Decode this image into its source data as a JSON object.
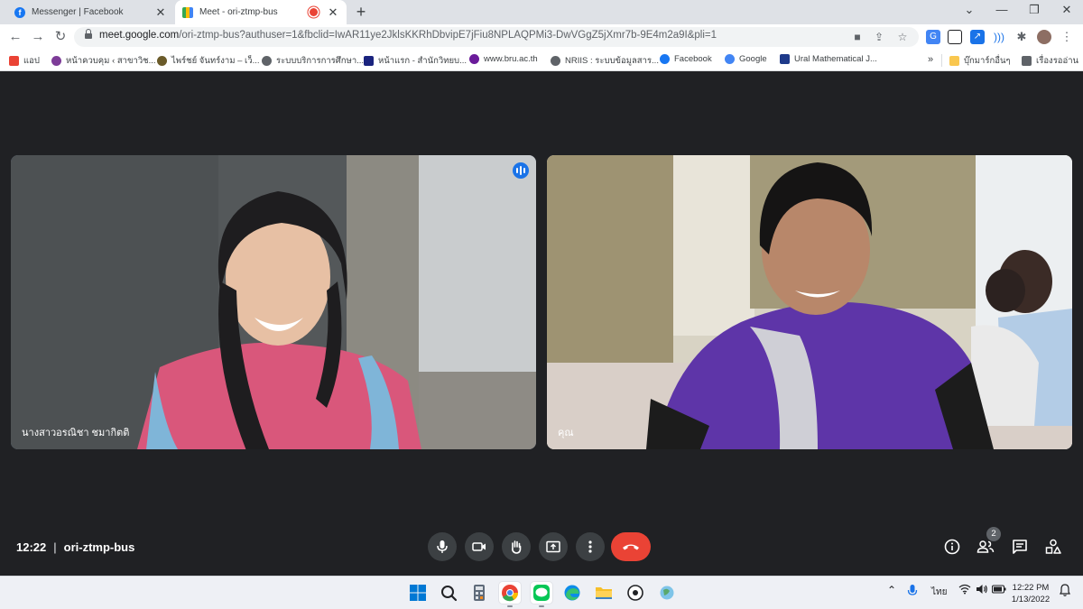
{
  "tabs": [
    {
      "title": "Messenger | Facebook",
      "favicon": "facebook-icon"
    },
    {
      "title": "Meet - ori-ztmp-bus",
      "favicon": "google-meet-icon",
      "recording": true
    }
  ],
  "address": {
    "host": "meet.google.com",
    "path": "/ori-ztmp-bus?authuser=1&fbclid=IwAR11ye2JklsKKRhDbvipE7jFiu8NPLAQPMi3-DwVGgZ5jXmr7b-9E4m2a9I&pli=1"
  },
  "bookmarks": [
    {
      "label": "แอป",
      "icon": "apps-grid-icon",
      "color": "#ea4335"
    },
    {
      "label": "หน้าควบคุม ‹ สาขาวิช...",
      "icon": "wordpress-icon",
      "color": "#7d3c98"
    },
    {
      "label": "ไพร์ชย์ จันทร์งาม – เว็...",
      "icon": "site-icon",
      "color": "#6b5b2a"
    },
    {
      "label": "ระบบบริการการศึกษา...",
      "icon": "globe-icon",
      "color": "#5f6368"
    },
    {
      "label": "หน้าแรก - สำนักวิทยบ...",
      "icon": "library-icon",
      "color": "#1a237e"
    },
    {
      "label": "www.bru.ac.th",
      "icon": "bru-icon",
      "color": "#6a1b9a"
    },
    {
      "label": "NRIIS : ระบบข้อมูลสาร...",
      "icon": "globe-icon",
      "color": "#5f6368"
    },
    {
      "label": "Facebook",
      "icon": "facebook-icon",
      "color": "#1877f2"
    },
    {
      "label": "Google",
      "icon": "google-icon",
      "color": "#4285f4"
    },
    {
      "label": "Ural Mathematical J...",
      "icon": "journal-icon",
      "color": "#1e3a8a"
    }
  ],
  "bookmarks_right": [
    {
      "label": "บุ๊กมาร์กอื่นๆ",
      "icon": "folder-icon",
      "color": "#f9c74f"
    },
    {
      "label": "เรื่องรออ่าน",
      "icon": "reading-list-icon",
      "color": "#5f6368"
    }
  ],
  "meeting": {
    "time": "12:22",
    "code": "ori-ztmp-bus",
    "participants_count": "2",
    "tiles": [
      {
        "name": "นางสาวอรณิชา ชมากิตติ",
        "speaking": true
      },
      {
        "name": "คุณ",
        "speaking": false
      }
    ]
  },
  "taskbar": {
    "language": "ไทย",
    "time": "12:22 PM",
    "date": "1/13/2022"
  },
  "colors": {
    "meet_bg": "#202124",
    "control_bg": "#3c4043",
    "end_call": "#ea4335",
    "active_speaker": "#8ab4f8"
  }
}
